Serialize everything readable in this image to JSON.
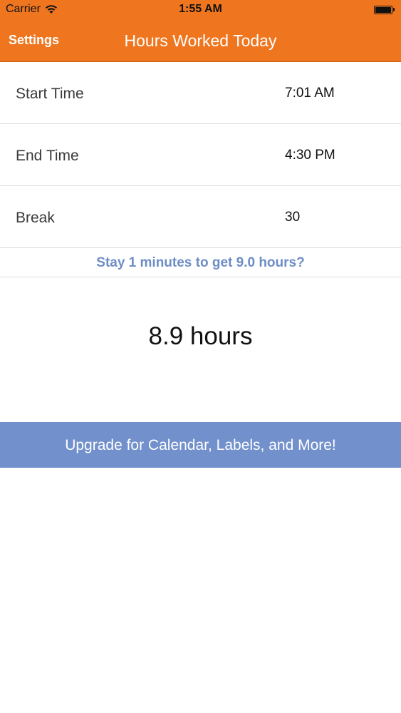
{
  "status_bar": {
    "carrier": "Carrier",
    "time": "1:55 AM",
    "battery_level": 1.0
  },
  "nav": {
    "left_button": "Settings",
    "title": "Hours Worked Today"
  },
  "rows": [
    {
      "label": "Start Time",
      "value": "7:01 AM"
    },
    {
      "label": "End Time",
      "value": "4:30 PM"
    },
    {
      "label": "Break",
      "value": "30"
    }
  ],
  "hint": "Stay 1 minutes to get 9.0 hours?",
  "total": "8.9 hours",
  "upgrade_label": "Upgrade for Calendar, Labels, and More!",
  "colors": {
    "nav_background": "#ef761f",
    "accent_blue": "#6d8dc6",
    "upgrade_background": "#7290cc"
  }
}
